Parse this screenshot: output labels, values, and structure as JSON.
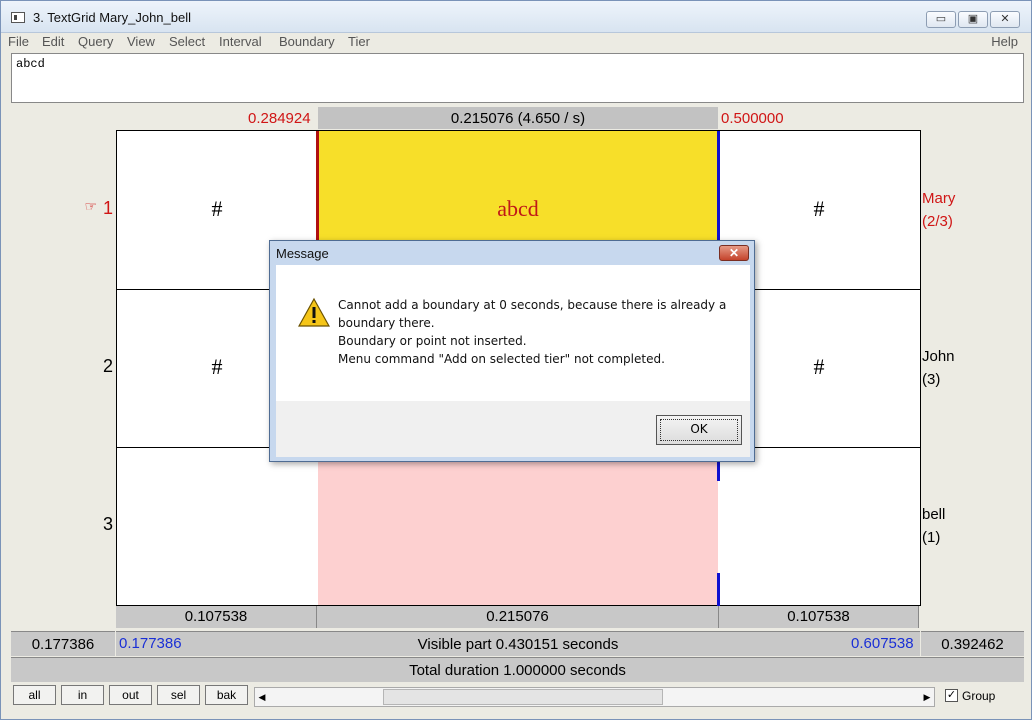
{
  "window": {
    "title": "3. TextGrid Mary_John_bell",
    "btn_min": "▭",
    "btn_max": "▣",
    "btn_close": "✕"
  },
  "menu": {
    "items": [
      "File",
      "Edit",
      "Query",
      "View",
      "Select",
      "Interval",
      "Boundary",
      "Tier"
    ],
    "help": "Help"
  },
  "textbox": {
    "value": "abcd"
  },
  "selection": {
    "left_time": "0.284924",
    "duration_label": "0.215076 (4.650 / s)",
    "right_time": "0.500000"
  },
  "tiers": [
    {
      "number": "1",
      "name": "Mary",
      "count": "(2/3)",
      "left_text": "#",
      "mid_text": "abcd",
      "right_text": "#",
      "pointer": "☞"
    },
    {
      "number": "2",
      "name": "John",
      "count": "(3)",
      "left_text": "#",
      "mid_text": "",
      "right_text": "#"
    },
    {
      "number": "3",
      "name": "bell",
      "count": "(1)",
      "left_text": "",
      "mid_text": "",
      "right_text": ""
    }
  ],
  "durations": {
    "left": "0.107538",
    "middle": "0.215076",
    "right": "0.107538"
  },
  "visible": {
    "left_outside": "0.177386",
    "start": "0.177386",
    "label": "Visible part 0.430151 seconds",
    "end": "0.607538",
    "right_outside": "0.392462"
  },
  "total": {
    "label": "Total duration 1.000000 seconds"
  },
  "buttons": {
    "all": "all",
    "in": "in",
    "out": "out",
    "sel": "sel",
    "bak": "bak"
  },
  "scroll": {
    "left_arrow": "◀",
    "right_arrow": "▶"
  },
  "group": {
    "label": "Group",
    "checked": "✓"
  },
  "dialog": {
    "title": "Message",
    "close": "✕",
    "lines": [
      "Cannot add a boundary at 0 seconds, because there is already a",
      "boundary there.",
      "Boundary or point not inserted.",
      "Menu command \"Add on selected tier\" not completed."
    ],
    "ok": "OK"
  },
  "colors": {
    "selection_yellow": "#f7df29",
    "selection_pink": "#fdd0d0",
    "time_red": "#d01515",
    "time_blue": "#1a2fd6",
    "boundary_blue": "#1010d0"
  }
}
